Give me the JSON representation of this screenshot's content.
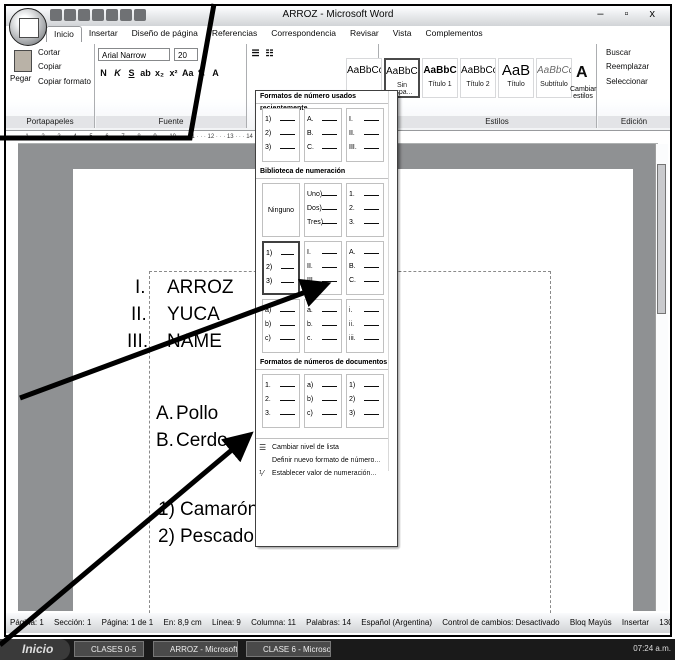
{
  "window": {
    "title": "ARROZ - Microsoft Word",
    "controls": "– ▫ x"
  },
  "tabs": [
    "Inicio",
    "Insertar",
    "Diseño de página",
    "Referencias",
    "Correspondencia",
    "Revisar",
    "Vista",
    "Complementos"
  ],
  "clipboard": {
    "paste": "Pegar",
    "cut": "Cortar",
    "copy": "Copiar",
    "format_painter": "Copiar formato",
    "group": "Portapapeles"
  },
  "font": {
    "name": "Arial Narrow",
    "size": "20",
    "group": "Fuente"
  },
  "styles": {
    "group": "Estilos",
    "items": [
      {
        "sample": "AaBbCcDc",
        "name": ""
      },
      {
        "sample": "AaBbCcDc",
        "name": "Sin espa..."
      },
      {
        "sample": "AaBbC",
        "name": "Título 1"
      },
      {
        "sample": "AaBbCc",
        "name": "Título 2"
      },
      {
        "sample": "AaB",
        "name": "Título"
      },
      {
        "sample": "AaBbCc.",
        "name": "Subtítulo"
      }
    ],
    "change_styles": "Cambiar estilos"
  },
  "editing": {
    "find": "Buscar",
    "replace": "Reemplazar",
    "select": "Seleccionar",
    "group": "Edición"
  },
  "dropdown": {
    "recent_header": "Formatos de número usados recientemente",
    "recent": [
      [
        "1)",
        "2)",
        "3)"
      ],
      [
        "A.",
        "B.",
        "C."
      ],
      [
        "I.",
        "II.",
        "III."
      ]
    ],
    "library_header": "Biblioteca de numeración",
    "none_label": "Ninguno",
    "library_row1": [
      [
        "Uno)",
        "Dos)",
        "Tres)"
      ],
      [
        "1.",
        "2.",
        "3."
      ]
    ],
    "library_row2": [
      [
        "1)",
        "2)",
        "3)"
      ],
      [
        "I.",
        "II.",
        "III."
      ],
      [
        "A.",
        "B.",
        "C."
      ]
    ],
    "library_row3": [
      [
        "a)",
        "b)",
        "c)"
      ],
      [
        "a.",
        "b.",
        "c."
      ],
      [
        "i.",
        "ii.",
        "iii."
      ]
    ],
    "doc_header": "Formatos de números de documentos",
    "doc_formats": [
      [
        "1.",
        "2.",
        "3."
      ],
      [
        "a)",
        "b)",
        "c)"
      ],
      [
        "1)",
        "2)",
        "3)"
      ]
    ],
    "commands": [
      "Cambiar nivel de lista",
      "Definir nuevo formato de número...",
      "Establecer valor de numeración..."
    ]
  },
  "document": {
    "roman": [
      {
        "n": "I.",
        "t": "ARROZ"
      },
      {
        "n": "II.",
        "t": "YUCA"
      },
      {
        "n": "III.",
        "t": "NAME"
      }
    ],
    "letters": [
      {
        "n": "A.",
        "t": "Pollo"
      },
      {
        "n": "B.",
        "t": "Cerdo"
      }
    ],
    "numbers": [
      {
        "n": "1)",
        "t": "Camarón"
      },
      {
        "n": "2)",
        "t": "Pescado"
      }
    ]
  },
  "status": {
    "items": [
      "Página: 1",
      "Sección: 1",
      "Página: 1 de 1",
      "En: 8,9 cm",
      "Línea: 9",
      "Columna: 11",
      "Palabras: 14",
      "Español (Argentina)",
      "Control de cambios: Desactivado",
      "Bloq Mayús",
      "Insertar"
    ],
    "zoom": "130%"
  },
  "taskbar": {
    "start": "Inicio",
    "tasks": [
      "CLASES 0-5",
      "ARROZ - Microsoft W...",
      "CLASE 6 - Microsoft ..."
    ],
    "clock": "07:24 a.m."
  }
}
